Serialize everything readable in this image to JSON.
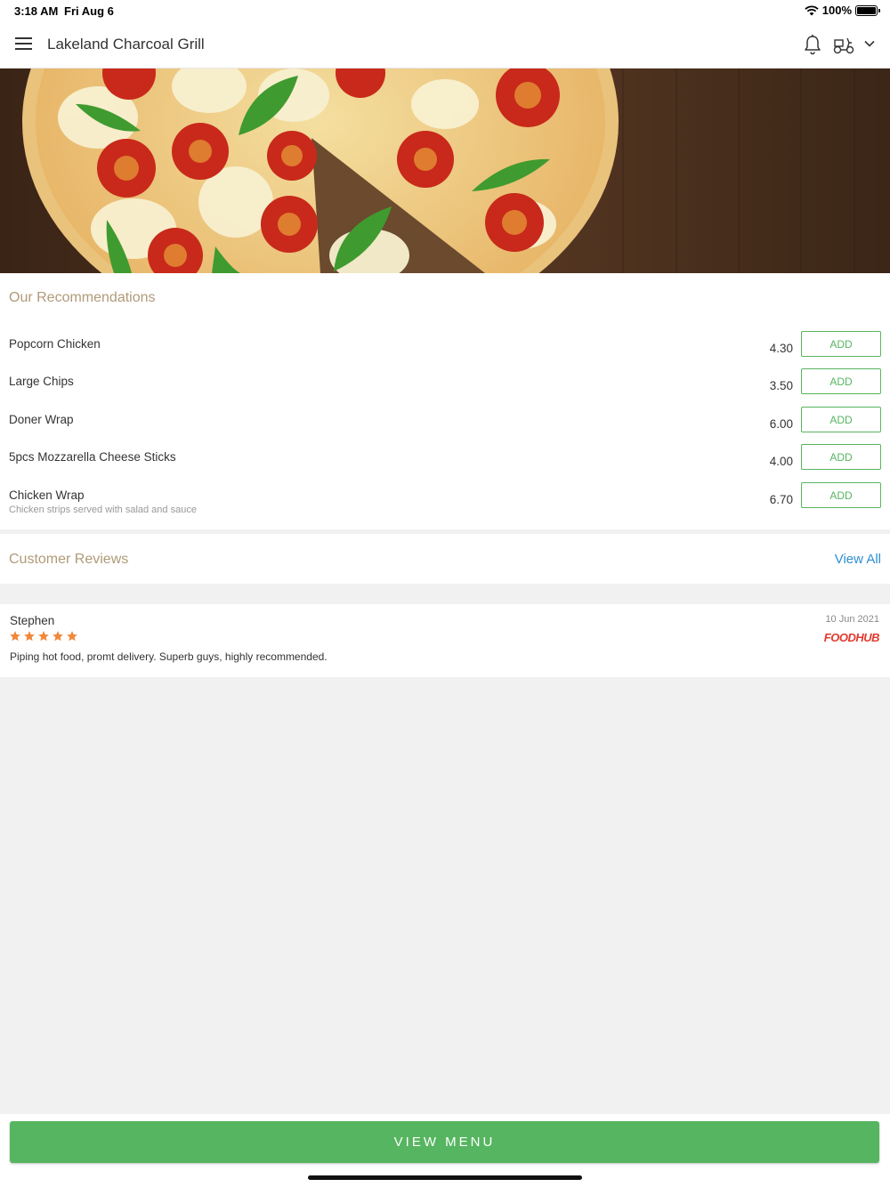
{
  "status_bar": {
    "time": "3:18 AM",
    "date": "Fri Aug 6",
    "battery": "100%",
    "battery_level": 1.0
  },
  "header": {
    "title": "Lakeland Charcoal Grill",
    "icons": [
      "menu-icon",
      "bell-icon",
      "scooter-icon",
      "chevron-down-icon"
    ]
  },
  "hero": {
    "image": "pizza-margherita-photo"
  },
  "recommendations": {
    "title": "Our Recommendations",
    "add_label": "ADD",
    "items": [
      {
        "name": "Popcorn Chicken",
        "description": "",
        "price": "4.30"
      },
      {
        "name": "Large Chips",
        "description": "",
        "price": "3.50"
      },
      {
        "name": "Doner Wrap",
        "description": "",
        "price": "6.00"
      },
      {
        "name": "5pcs Mozzarella Cheese Sticks",
        "description": "",
        "price": "4.00"
      },
      {
        "name": "Chicken Wrap",
        "description": "Chicken strips served with salad and sauce",
        "price": "6.70"
      }
    ]
  },
  "reviews": {
    "title": "Customer Reviews",
    "view_all": "View All",
    "items": [
      {
        "author": "Stephen",
        "rating": 5,
        "date": "10 Jun 2021",
        "source": "FOODHUB",
        "text": "Piping hot food, promt delivery. Superb guys, highly recommended."
      }
    ]
  },
  "footer": {
    "view_menu": "VIEW MENU"
  },
  "colors": {
    "accent_green": "#56b560",
    "section_title": "#b09a78",
    "link_blue": "#2f8fd0",
    "star_orange": "#f0883a",
    "brand_red": "#e23a2f"
  }
}
